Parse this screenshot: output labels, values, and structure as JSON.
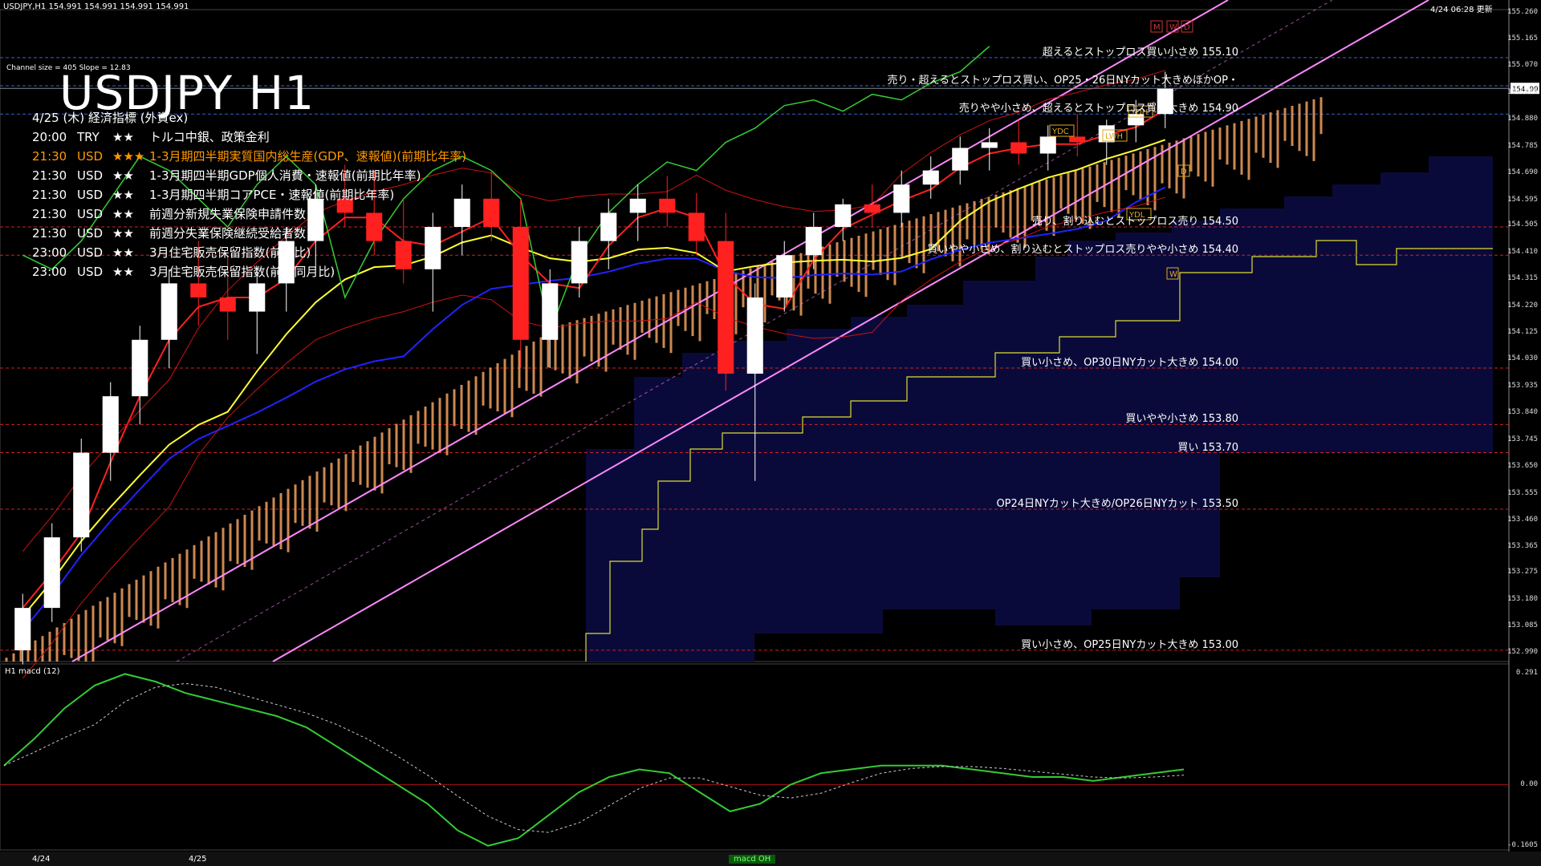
{
  "header": {
    "symbol_line": "USDJPY,H1  154.991 154.991 154.991 154.991",
    "datetime": "4/24 06:28 更新",
    "channel_info": "Channel size = 405 Slope = 12.83"
  },
  "title": "USDJPY H1",
  "calendar": {
    "date_line": "4/25 (木) 経済指標 (外資ex)",
    "events": [
      {
        "time": "20:00",
        "ccy": "TRY",
        "stars": "★★",
        "name": "トルコ中銀、政策金利",
        "color": "#ffffff"
      },
      {
        "time": "21:30",
        "ccy": "USD",
        "stars": "★★★",
        "name": "1-3月期四半期実質国内総生産(GDP、速報値)(前期比年率)",
        "color": "#ff9900"
      },
      {
        "time": "21:30",
        "ccy": "USD",
        "stars": "★★",
        "name": "1-3月期四半期GDP個人消費・速報値(前期比年率)",
        "color": "#ffffff"
      },
      {
        "time": "21:30",
        "ccy": "USD",
        "stars": "★★",
        "name": "1-3月期四半期コアPCE・速報値(前期比年率)",
        "color": "#ffffff"
      },
      {
        "time": "21:30",
        "ccy": "USD",
        "stars": "★★",
        "name": "前週分新規失業保険申請件数",
        "color": "#ffffff"
      },
      {
        "time": "21:30",
        "ccy": "USD",
        "stars": "★★",
        "name": "前週分失業保険継続受給者数",
        "color": "#ffffff"
      },
      {
        "time": "23:00",
        "ccy": "USD",
        "stars": "★★",
        "name": "3月住宅販売保留指数(前月比)",
        "color": "#ffffff"
      },
      {
        "time": "23:00",
        "ccy": "USD",
        "stars": "★★",
        "name": "3月住宅販売保留指数(前年同月比)",
        "color": "#ffffff"
      }
    ]
  },
  "annotations": [
    {
      "text": "超えるとストップロス買い小さめ 155.10",
      "price": 155.1
    },
    {
      "text": "売り・超えるとストップロス買い、OP25・26日NYカット大きめほかOP・",
      "price": 155.0
    },
    {
      "text": "売りやや小さめ、超えるとストップロス買い大きめ 154.90",
      "price": 154.9
    },
    {
      "text": "売り、割り込むとストップロス売り 154.50",
      "price": 154.5
    },
    {
      "text": "買いやや小さめ、割り込むとストップロス売りやや小さめ 154.40",
      "price": 154.4
    },
    {
      "text": "買い小さめ、OP30日NYカット大きめ 154.00",
      "price": 154.0
    },
    {
      "text": "買いやや小さめ 153.80",
      "price": 153.8
    },
    {
      "text": "買い 153.70",
      "price": 153.7
    },
    {
      "text": "OP24日NYカット大きめ/OP26日NYカット 153.50",
      "price": 153.5
    },
    {
      "text": "買い小さめ、OP25日NYカット大きめ 153.00",
      "price": 153.0
    }
  ],
  "marker_labels": [
    "YDC",
    "LWH",
    "YDH",
    "YDL",
    "D",
    "W",
    "M",
    "W",
    "D"
  ],
  "price_axis": {
    "ticks": [
      "155.260",
      "155.165",
      "155.070",
      "154.975",
      "154.880",
      "154.785",
      "154.690",
      "154.595",
      "154.505",
      "154.410",
      "154.315",
      "154.220",
      "154.125",
      "154.030",
      "153.935",
      "153.840",
      "153.745",
      "153.650",
      "153.555",
      "153.460",
      "153.365",
      "153.275",
      "153.180",
      "153.085",
      "152.990"
    ],
    "current": "154.991",
    "ylim": [
      152.96,
      155.27
    ]
  },
  "indicator": {
    "label": "H1  macd (12)",
    "ticks": [
      "0.291",
      "0.00",
      "-0.1605"
    ]
  },
  "time_axis": {
    "labels": [
      "4/24",
      "4/25"
    ]
  },
  "tab_label": "macd OH",
  "chart_data": {
    "type": "candlestick",
    "title": "USDJPY H1",
    "ylim": [
      152.96,
      155.27
    ],
    "candles": [
      {
        "o": 153.0,
        "h": 153.2,
        "l": 152.95,
        "c": 153.15
      },
      {
        "o": 153.15,
        "h": 153.45,
        "l": 153.1,
        "c": 153.4
      },
      {
        "o": 153.4,
        "h": 153.75,
        "l": 153.35,
        "c": 153.7
      },
      {
        "o": 153.7,
        "h": 153.95,
        "l": 153.6,
        "c": 153.9
      },
      {
        "o": 153.9,
        "h": 154.15,
        "l": 153.8,
        "c": 154.1
      },
      {
        "o": 154.1,
        "h": 154.35,
        "l": 154.0,
        "c": 154.3
      },
      {
        "o": 154.3,
        "h": 154.45,
        "l": 154.15,
        "c": 154.25
      },
      {
        "o": 154.25,
        "h": 154.4,
        "l": 154.1,
        "c": 154.2
      },
      {
        "o": 154.2,
        "h": 154.35,
        "l": 154.05,
        "c": 154.3
      },
      {
        "o": 154.3,
        "h": 154.5,
        "l": 154.2,
        "c": 154.45
      },
      {
        "o": 154.45,
        "h": 154.65,
        "l": 154.35,
        "c": 154.6
      },
      {
        "o": 154.6,
        "h": 154.72,
        "l": 154.5,
        "c": 154.55
      },
      {
        "o": 154.55,
        "h": 154.7,
        "l": 154.4,
        "c": 154.45
      },
      {
        "o": 154.45,
        "h": 154.6,
        "l": 154.3,
        "c": 154.35
      },
      {
        "o": 154.35,
        "h": 154.55,
        "l": 154.2,
        "c": 154.5
      },
      {
        "o": 154.5,
        "h": 154.65,
        "l": 154.4,
        "c": 154.6
      },
      {
        "o": 154.6,
        "h": 154.7,
        "l": 154.45,
        "c": 154.5
      },
      {
        "o": 154.5,
        "h": 154.6,
        "l": 154.0,
        "c": 154.1
      },
      {
        "o": 154.1,
        "h": 154.35,
        "l": 154.0,
        "c": 154.3
      },
      {
        "o": 154.3,
        "h": 154.5,
        "l": 154.25,
        "c": 154.45
      },
      {
        "o": 154.45,
        "h": 154.6,
        "l": 154.35,
        "c": 154.55
      },
      {
        "o": 154.55,
        "h": 154.65,
        "l": 154.45,
        "c": 154.6
      },
      {
        "o": 154.6,
        "h": 154.68,
        "l": 154.5,
        "c": 154.55
      },
      {
        "o": 154.55,
        "h": 154.62,
        "l": 154.4,
        "c": 154.45
      },
      {
        "o": 154.45,
        "h": 154.55,
        "l": 153.92,
        "c": 153.98
      },
      {
        "o": 153.98,
        "h": 154.3,
        "l": 153.6,
        "c": 154.25
      },
      {
        "o": 154.25,
        "h": 154.45,
        "l": 154.2,
        "c": 154.4
      },
      {
        "o": 154.4,
        "h": 154.55,
        "l": 154.35,
        "c": 154.5
      },
      {
        "o": 154.5,
        "h": 154.6,
        "l": 154.45,
        "c": 154.58
      },
      {
        "o": 154.58,
        "h": 154.65,
        "l": 154.5,
        "c": 154.55
      },
      {
        "o": 154.55,
        "h": 154.7,
        "l": 154.5,
        "c": 154.65
      },
      {
        "o": 154.65,
        "h": 154.75,
        "l": 154.6,
        "c": 154.7
      },
      {
        "o": 154.7,
        "h": 154.82,
        "l": 154.65,
        "c": 154.78
      },
      {
        "o": 154.78,
        "h": 154.85,
        "l": 154.7,
        "c": 154.8
      },
      {
        "o": 154.8,
        "h": 154.88,
        "l": 154.72,
        "c": 154.76
      },
      {
        "o": 154.76,
        "h": 154.86,
        "l": 154.7,
        "c": 154.82
      },
      {
        "o": 154.82,
        "h": 154.9,
        "l": 154.75,
        "c": 154.8
      },
      {
        "o": 154.8,
        "h": 154.88,
        "l": 154.72,
        "c": 154.86
      },
      {
        "o": 154.86,
        "h": 154.95,
        "l": 154.8,
        "c": 154.9
      },
      {
        "o": 154.9,
        "h": 155.05,
        "l": 154.85,
        "c": 154.99
      }
    ],
    "macd": [
      0.05,
      0.12,
      0.2,
      0.26,
      0.29,
      0.27,
      0.24,
      0.22,
      0.2,
      0.18,
      0.15,
      0.1,
      0.05,
      0.0,
      -0.05,
      -0.12,
      -0.16,
      -0.14,
      -0.08,
      -0.02,
      0.02,
      0.04,
      0.03,
      -0.02,
      -0.07,
      -0.05,
      0.0,
      0.03,
      0.04,
      0.05,
      0.05,
      0.05,
      0.04,
      0.03,
      0.02,
      0.02,
      0.01,
      0.02,
      0.03,
      0.04
    ],
    "macd_ylim": [
      -0.1605,
      0.291
    ]
  },
  "colors": {
    "bull": "#ffffff",
    "bear": "#ff2020",
    "sma_fast": "#ff2020",
    "sma_mid": "#ffff33",
    "sma_slow": "#2222ff",
    "bollinger": "#cc1111",
    "chikou": "#33cc33",
    "channel": "#ff88ff",
    "cloud": "#f0a060",
    "kumo_fill": "#0a0a3a",
    "level": "#cc2222",
    "level_blue": "#3366cc",
    "macd_line": "#33cc33",
    "macd_neg": "#ff8899",
    "signal": "#cccccc"
  }
}
